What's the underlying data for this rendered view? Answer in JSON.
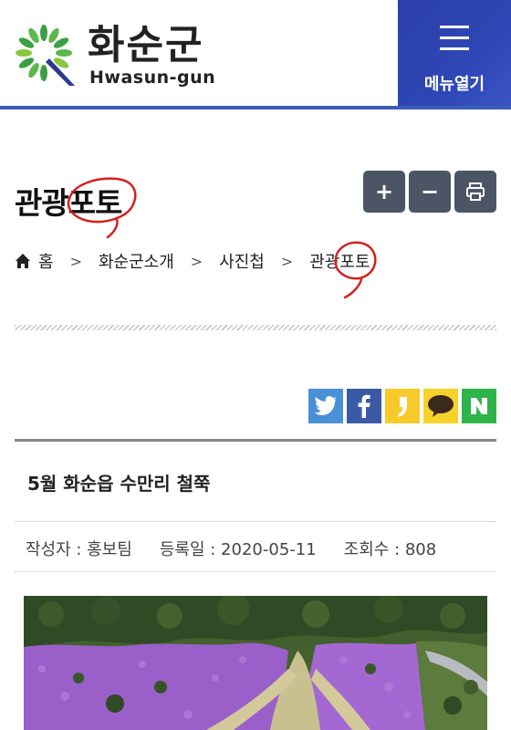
{
  "header": {
    "logo_title": "화순군",
    "logo_subtitle": "Hwasun-gun",
    "menu_label": "메뉴열기"
  },
  "page": {
    "title": "관광포토"
  },
  "tools": {
    "zoom_in": "+",
    "zoom_out": "−"
  },
  "breadcrumb": {
    "items": [
      "홈",
      "화순군소개",
      "사진첩",
      "관광포토"
    ],
    "separator": ">"
  },
  "share": {
    "items": [
      "twitter-icon",
      "facebook-icon",
      "kakaostory-icon",
      "kakaotalk-icon",
      "naver-icon"
    ]
  },
  "article": {
    "title": "5월 화순읍 수만리 철쭉",
    "author": "작성자 : 홍보팀",
    "date": "등록일 : 2020-05-11",
    "views": "조회수 : 808"
  },
  "colors": {
    "brand_blue": "#2e46b5",
    "tool_gray": "#4b5566",
    "annotation_red": "#d42020"
  }
}
